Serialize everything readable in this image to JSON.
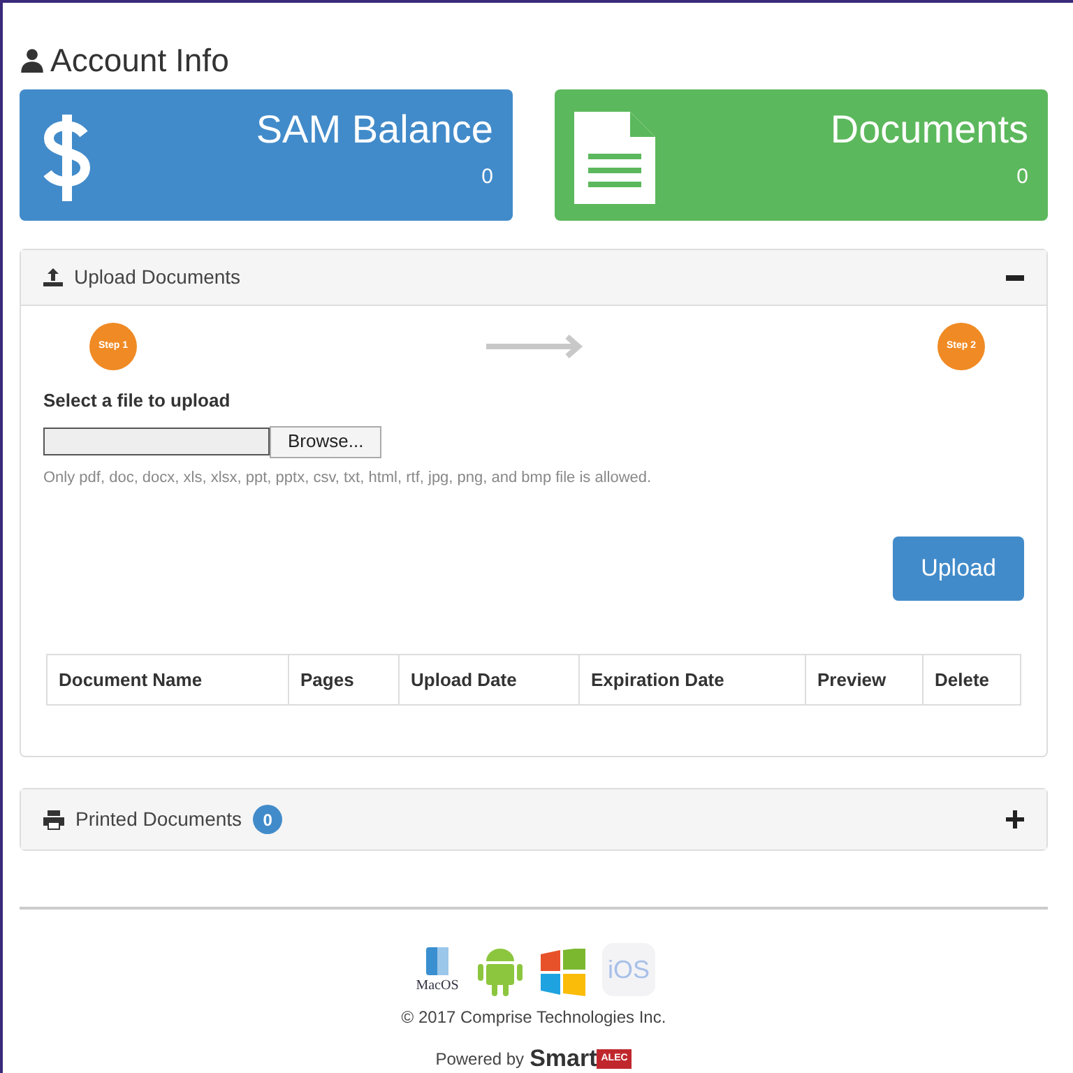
{
  "title": "Account Info",
  "tiles": [
    {
      "kind": "balance",
      "label": "SAM Balance",
      "value": "0",
      "color": "#428bca"
    },
    {
      "kind": "documents",
      "label": "Documents",
      "value": "0",
      "color": "#5cb85c"
    }
  ],
  "upload_panel": {
    "title": "Upload Documents",
    "expanded": true,
    "steps": [
      "Step 1",
      "Step 2"
    ],
    "file_label": "Select a file to upload",
    "browse": "Browse...",
    "hint": "Only pdf, doc, docx, xls, xlsx, ppt, pptx, csv, txt, html, rtf, jpg, png, and bmp file is allowed.",
    "upload_button": "Upload",
    "table": {
      "columns": [
        "Document Name",
        "Pages",
        "Upload Date",
        "Expiration Date",
        "Preview",
        "Delete"
      ]
    }
  },
  "printed_panel": {
    "title": "Printed Documents",
    "count": "0",
    "expanded": false
  },
  "footer": {
    "platforms": [
      "MacOS",
      "iOS"
    ],
    "copyright": "© 2017 Comprise Technologies Inc.",
    "powered_by": "Powered by",
    "brand": "Smart",
    "brand_badge": "ALEC"
  }
}
